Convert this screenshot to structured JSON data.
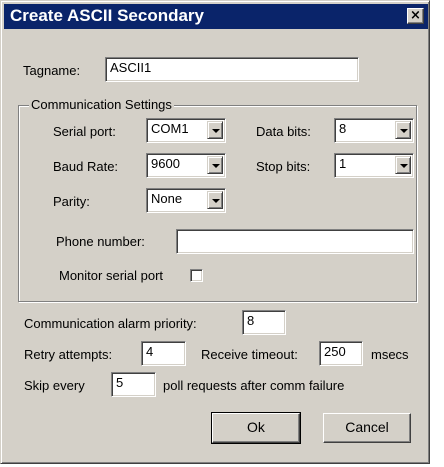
{
  "window": {
    "title": "Create ASCII Secondary",
    "close_symbol": "×"
  },
  "tagname": {
    "label": "Tagname:",
    "value": "ASCII1"
  },
  "comm": {
    "group_title": "Communication Settings",
    "serial_port": {
      "label": "Serial port:",
      "value": "COM1"
    },
    "data_bits": {
      "label": "Data bits:",
      "value": "8"
    },
    "baud_rate": {
      "label": "Baud Rate:",
      "value": "9600"
    },
    "stop_bits": {
      "label": "Stop bits:",
      "value": "1"
    },
    "parity": {
      "label": "Parity:",
      "value": "None"
    },
    "phone_number": {
      "label": "Phone number:",
      "value": ""
    },
    "monitor": {
      "label": "Monitor serial port",
      "checked": false
    }
  },
  "alarm_priority": {
    "label": "Communication alarm priority:",
    "value": "8"
  },
  "retry": {
    "label": "Retry attempts:",
    "value": "4"
  },
  "receive_timeout": {
    "label": "Receive timeout:",
    "value": "250",
    "unit": "msecs"
  },
  "skip": {
    "prefix": "Skip every",
    "value": "5",
    "suffix": "poll requests after comm failure"
  },
  "buttons": {
    "ok": "Ok",
    "cancel": "Cancel"
  }
}
